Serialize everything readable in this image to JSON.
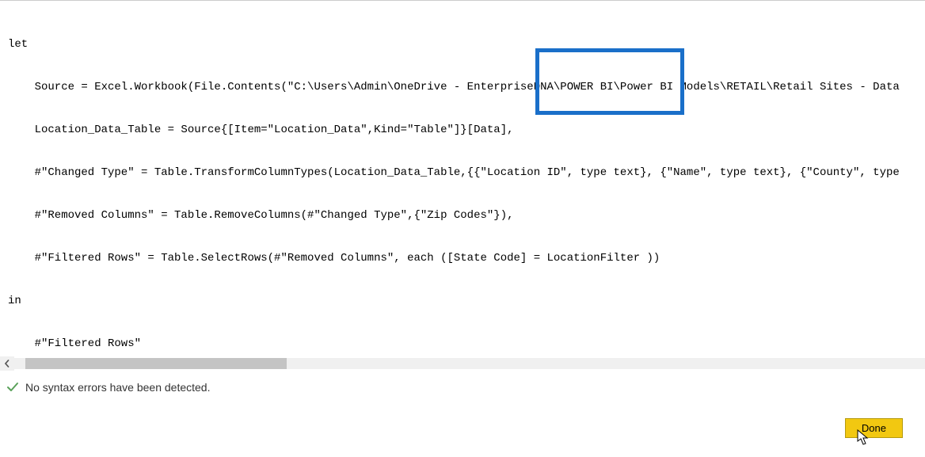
{
  "code": {
    "l1": "let",
    "l2": "Source = Excel.Workbook(File.Contents(\"C:\\Users\\Admin\\OneDrive - EnterpriseDNA\\POWER BI\\Power BI Models\\RETAIL\\Retail Sites - Data",
    "l3": "Location_Data_Table = Source{[Item=\"Location_Data\",Kind=\"Table\"]}[Data],",
    "l4": "#\"Changed Type\" = Table.TransformColumnTypes(Location_Data_Table,{{\"Location ID\", type text}, {\"Name\", type text}, {\"County\", type",
    "l5": "#\"Removed Columns\" = Table.RemoveColumns(#\"Changed Type\",{\"Zip Codes\"}),",
    "l6": "#\"Filtered Rows\" = Table.SelectRows(#\"Removed Columns\", each ([State Code] = LocationFilter ))",
    "l7": "in",
    "l8": "#\"Filtered Rows\""
  },
  "status": {
    "message": "No syntax errors have been detected."
  },
  "buttons": {
    "done": "Done"
  },
  "highlight": {
    "top": "60",
    "left": "676",
    "width": "188",
    "height": "84"
  }
}
